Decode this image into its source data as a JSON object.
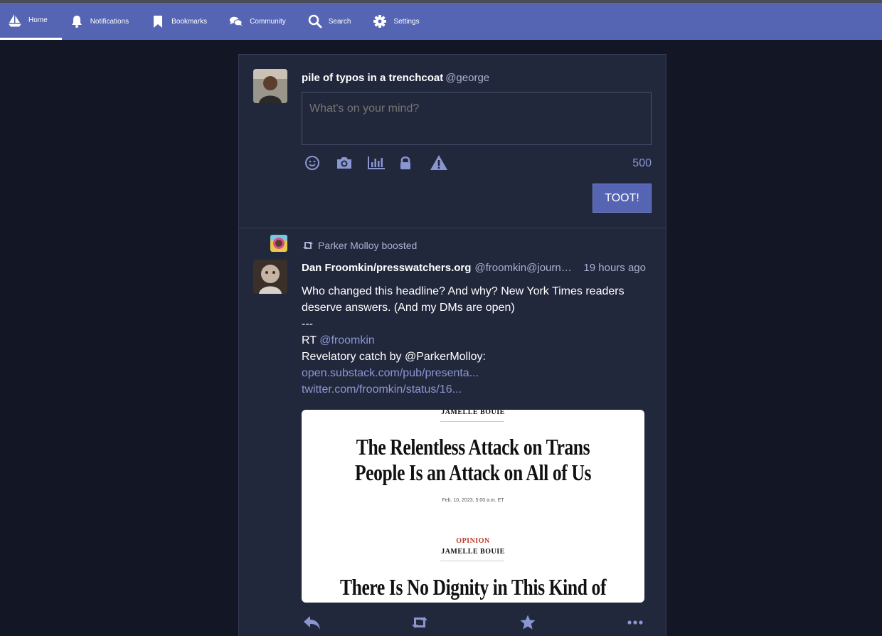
{
  "nav": {
    "items": [
      {
        "label": "Home",
        "icon": "sailboat-icon"
      },
      {
        "label": "Notifications",
        "icon": "bell-icon"
      },
      {
        "label": "Bookmarks",
        "icon": "bookmark-icon"
      },
      {
        "label": "Community",
        "icon": "comments-icon"
      },
      {
        "label": "Search",
        "icon": "search-icon"
      },
      {
        "label": "Settings",
        "icon": "gear-icon"
      }
    ],
    "active": "Home"
  },
  "compose": {
    "display_name": "pile of typos in a trenchcoat",
    "handle": "@george",
    "placeholder": "What's on your mind?",
    "value": "",
    "tools": [
      "emoji-icon",
      "camera-icon",
      "poll-icon",
      "lock-icon",
      "warning-icon"
    ],
    "char_count": "500",
    "submit_label": "TOOT!"
  },
  "status": {
    "boosted_by": "Parker Molloy boosted",
    "author_name": "Dan Froomkin/presswatchers.org",
    "author_acct": "@froomkin@journa....",
    "time": "19 hours ago",
    "content": {
      "line1": "Who changed this headline? And why? New York Times readers deserve answers. (And my DMs are open)",
      "line2": "---",
      "rt_prefix": "RT ",
      "rt_mention": "@froomkin",
      "line4": "Revelatory catch by @ParkerMolloy:",
      "link1": "open.substack.com/pub/presenta...",
      "link2": "twitter.com/froomkin/status/16..."
    },
    "media": {
      "author_top": "JAMELLE BOUIE",
      "headline1_a": "The Relentless Attack on Trans",
      "headline1_b": "People Is an Attack on All of Us",
      "date": "Feb. 10, 2023, 5:00 a.m. ET",
      "opinion": "OPINION",
      "author_bottom": "JAMELLE BOUIE",
      "headline2": "There Is No Dignity in This Kind of"
    },
    "actions": [
      "reply-icon",
      "boost-icon",
      "favourite-icon",
      "more-icon"
    ]
  },
  "colors": {
    "nav_bg": "#5565b4",
    "page_bg": "#121625",
    "column_bg": "#22283c",
    "accent": "#8a96d1"
  }
}
